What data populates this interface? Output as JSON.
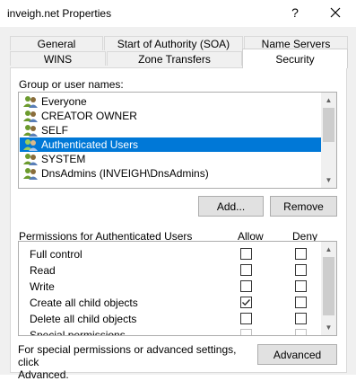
{
  "window": {
    "title": "inveigh.net Properties",
    "help_glyph": "?"
  },
  "tabs": {
    "row1": [
      "General",
      "Start of Authority (SOA)",
      "Name Servers"
    ],
    "row2": [
      "WINS",
      "Zone Transfers",
      "Security"
    ],
    "selected": "Security"
  },
  "group": {
    "label": "Group or user names:",
    "items": [
      "Everyone",
      "CREATOR OWNER",
      "SELF",
      "Authenticated Users",
      "SYSTEM",
      "DnsAdmins (INVEIGH\\DnsAdmins)"
    ],
    "selected_index": 3
  },
  "buttons": {
    "add": "Add...",
    "remove": "Remove",
    "advanced": "Advanced"
  },
  "permissions": {
    "label": "Permissions for Authenticated Users",
    "allow_header": "Allow",
    "deny_header": "Deny",
    "rows": [
      {
        "name": "Full control",
        "allow": false,
        "deny": false
      },
      {
        "name": "Read",
        "allow": false,
        "deny": false
      },
      {
        "name": "Write",
        "allow": false,
        "deny": false
      },
      {
        "name": "Create all child objects",
        "allow": true,
        "deny": false
      },
      {
        "name": "Delete all child objects",
        "allow": false,
        "deny": false
      },
      {
        "name": "Special permissions",
        "allow": false,
        "deny": false
      }
    ]
  },
  "hint": {
    "line1": "For special permissions or advanced settings, click",
    "line2": "Advanced."
  },
  "colors": {
    "selection": "#0078d7",
    "face": "#f0f0f0",
    "button": "#e1e1e1"
  }
}
